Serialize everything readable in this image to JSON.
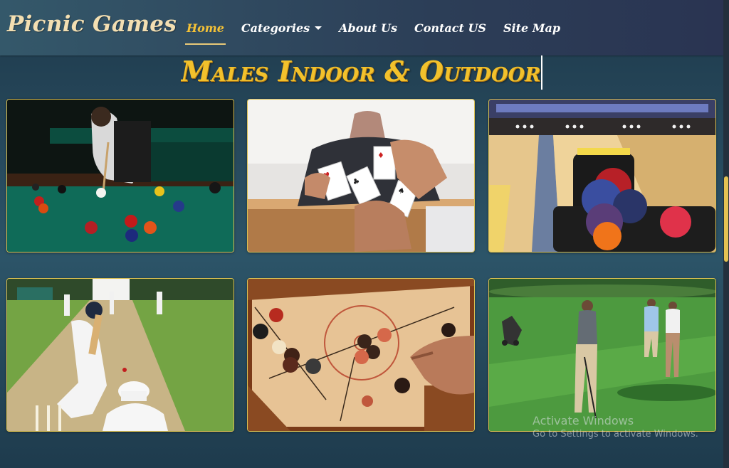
{
  "brand": "Picnic Games",
  "nav": {
    "home": "Home",
    "categories": "Categories",
    "about": "About Us",
    "contact": "Contact US",
    "sitemap": "Site Map",
    "active": "home"
  },
  "heading": "Males Indoor & Outdoor",
  "games": [
    {
      "name": "billiards-image"
    },
    {
      "name": "playing-cards-image"
    },
    {
      "name": "bowling-image"
    },
    {
      "name": "cricket-image"
    },
    {
      "name": "carrom-image"
    },
    {
      "name": "golf-image"
    }
  ],
  "watermark": {
    "title": "Activate Windows",
    "subtitle": "Go to Settings to activate Windows."
  },
  "colors": {
    "accent": "#f5c236",
    "heading": "#f2c12c",
    "card_border": "#d9bf52"
  }
}
